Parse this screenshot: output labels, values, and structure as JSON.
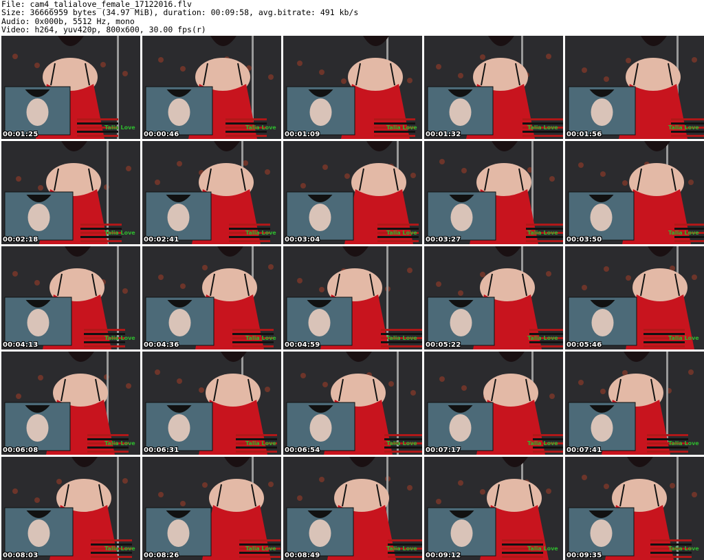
{
  "header": {
    "file": "File: cam4_talialove_female_17122016.flv",
    "size": "Size: 36666959 bytes (34.97 MiB), duration: 00:09:58, avg.bitrate: 491 kb/s",
    "audio": "Audio: 0x000b, 5512 Hz, mono",
    "video": "Video: h264, yuv420p, 800x600, 30.00 fps(r)"
  },
  "colors": {
    "backdrop": "#2b2b2e",
    "dress": "#c8141e",
    "skin": "#e3b9a6",
    "hair": "#1a1012",
    "overlay_bg": "#4c6a78",
    "watermark": "#2fb82f"
  },
  "watermark_text": "Talia Love",
  "thumbnails": [
    {
      "time": "00:01:25"
    },
    {
      "time": "00:00:46"
    },
    {
      "time": "00:01:09"
    },
    {
      "time": "00:01:32"
    },
    {
      "time": "00:01:56"
    },
    {
      "time": "00:02:18"
    },
    {
      "time": "00:02:41"
    },
    {
      "time": "00:03:04"
    },
    {
      "time": "00:03:27"
    },
    {
      "time": "00:03:50"
    },
    {
      "time": "00:04:13"
    },
    {
      "time": "00:04:36"
    },
    {
      "time": "00:04:59"
    },
    {
      "time": "00:05:22"
    },
    {
      "time": "00:05:46"
    },
    {
      "time": "00:06:08"
    },
    {
      "time": "00:06:31"
    },
    {
      "time": "00:06:54"
    },
    {
      "time": "00:07:17"
    },
    {
      "time": "00:07:41"
    },
    {
      "time": "00:08:03"
    },
    {
      "time": "00:08:26"
    },
    {
      "time": "00:08:49"
    },
    {
      "time": "00:09:12"
    },
    {
      "time": "00:09:35"
    }
  ]
}
